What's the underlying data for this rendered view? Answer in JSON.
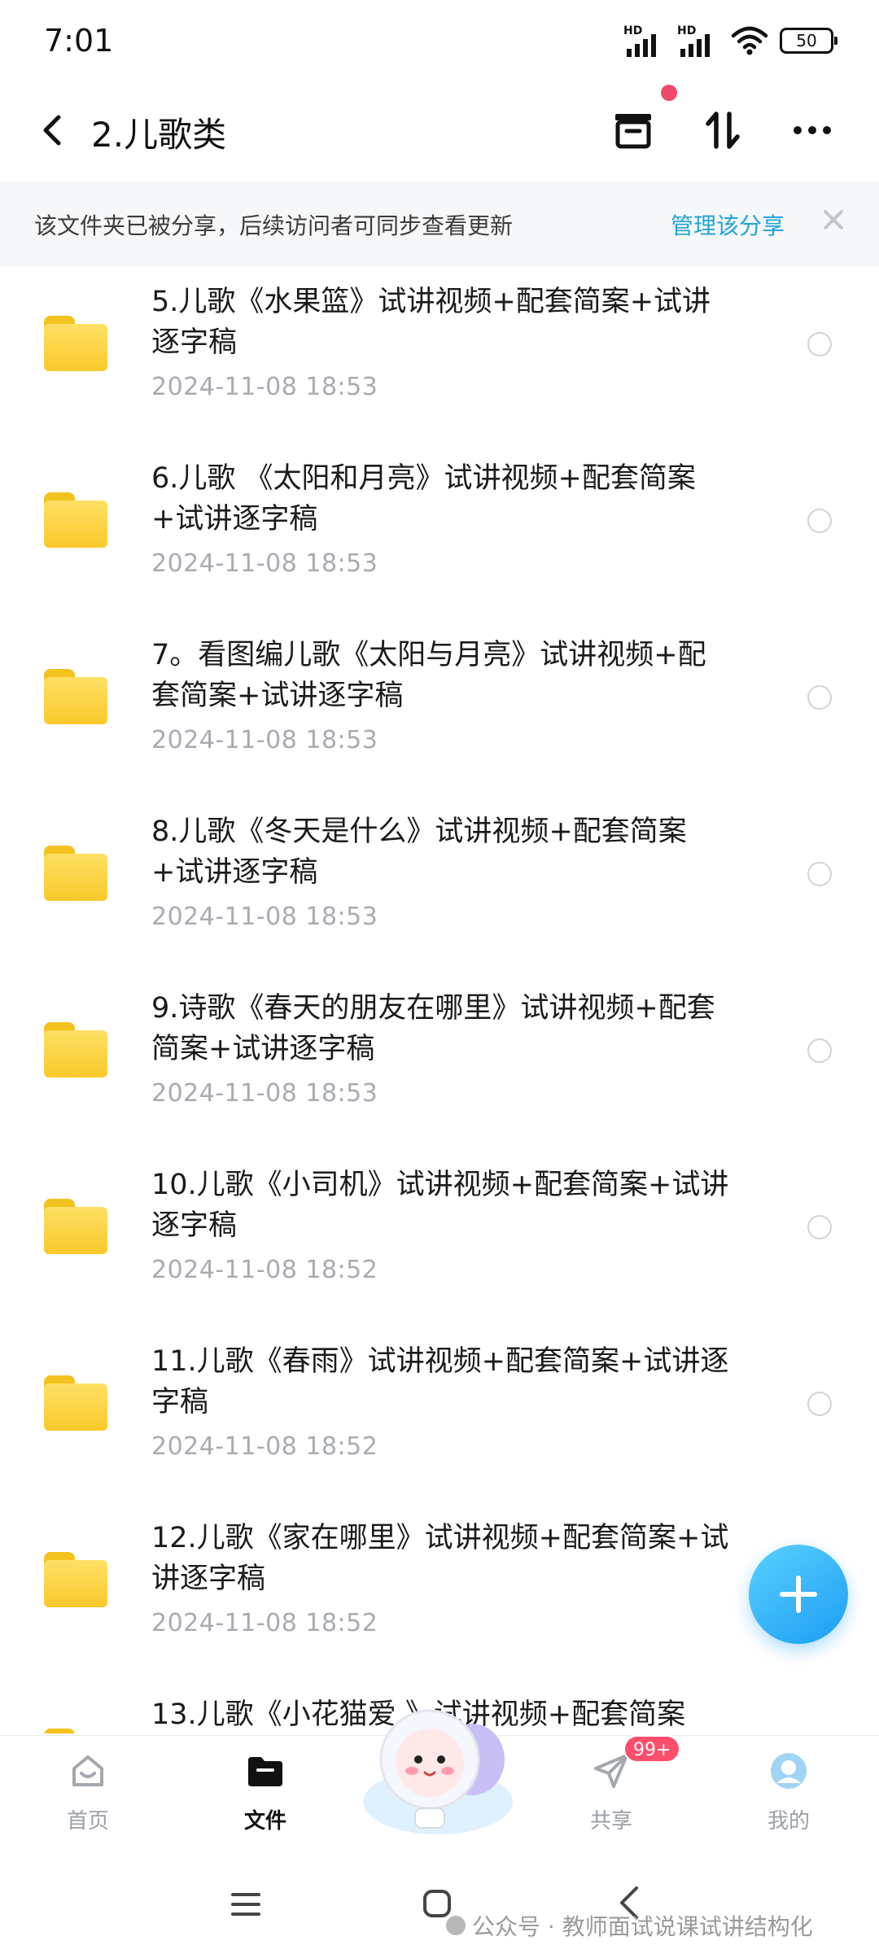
{
  "status_bar": {
    "time": "7:01",
    "signal_1_label": "HD",
    "signal_2_label": "HD",
    "battery": "50"
  },
  "header": {
    "title": "2.儿歌类",
    "back_icon": "chevron-left-icon",
    "actions": [
      "archive-icon",
      "sort-icon",
      "more-icon"
    ],
    "notification_dot_color": "#f04a6a"
  },
  "share_banner": {
    "text": "该文件夹已被分享，后续访问者可同步查看更新",
    "manage_label": "管理该分享",
    "accent_color": "#20a4d8"
  },
  "files": [
    {
      "name_line1": "5.儿歌《水果篮》试讲视频+配套简案+试讲",
      "name_line2": "逐字稿",
      "date": "2024-11-08  18:53"
    },
    {
      "name_line1": "6.儿歌 《太阳和月亮》试讲视频+配套简案",
      "name_line2": "+试讲逐字稿",
      "date": "2024-11-08  18:53"
    },
    {
      "name_line1": "7。看图编儿歌《太阳与月亮》试讲视频+配",
      "name_line2": "套简案+试讲逐字稿",
      "date": "2024-11-08  18:53"
    },
    {
      "name_line1": "8.儿歌《冬天是什么》试讲视频+配套简案",
      "name_line2": "+试讲逐字稿",
      "date": "2024-11-08  18:53"
    },
    {
      "name_line1": "9.诗歌《春天的朋友在哪里》试讲视频+配套",
      "name_line2": "简案+试讲逐字稿",
      "date": "2024-11-08  18:53"
    },
    {
      "name_line1": "10.儿歌《小司机》试讲视频+配套简案+试讲",
      "name_line2": "逐字稿",
      "date": "2024-11-08  18:52"
    },
    {
      "name_line1": "11.儿歌《春雨》试讲视频+配套简案+试讲逐",
      "name_line2": "字稿",
      "date": "2024-11-08  18:52"
    },
    {
      "name_line1": "12.儿歌《家在哪里》试讲视频+配套简案+试",
      "name_line2": "讲逐字稿",
      "date": "2024-11-08  18:52"
    },
    {
      "name_line1": "13.儿歌《小花猫爱   》试讲视频+配套简案",
      "name_line2": "",
      "date": ""
    }
  ],
  "fab": {
    "icon": "plus-icon"
  },
  "bottom_nav": {
    "home": "首页",
    "files": "文件",
    "share": "共享",
    "share_badge": "99+",
    "mine": "我的"
  },
  "watermark": "公众号 · 教师面试说课试讲结构化"
}
